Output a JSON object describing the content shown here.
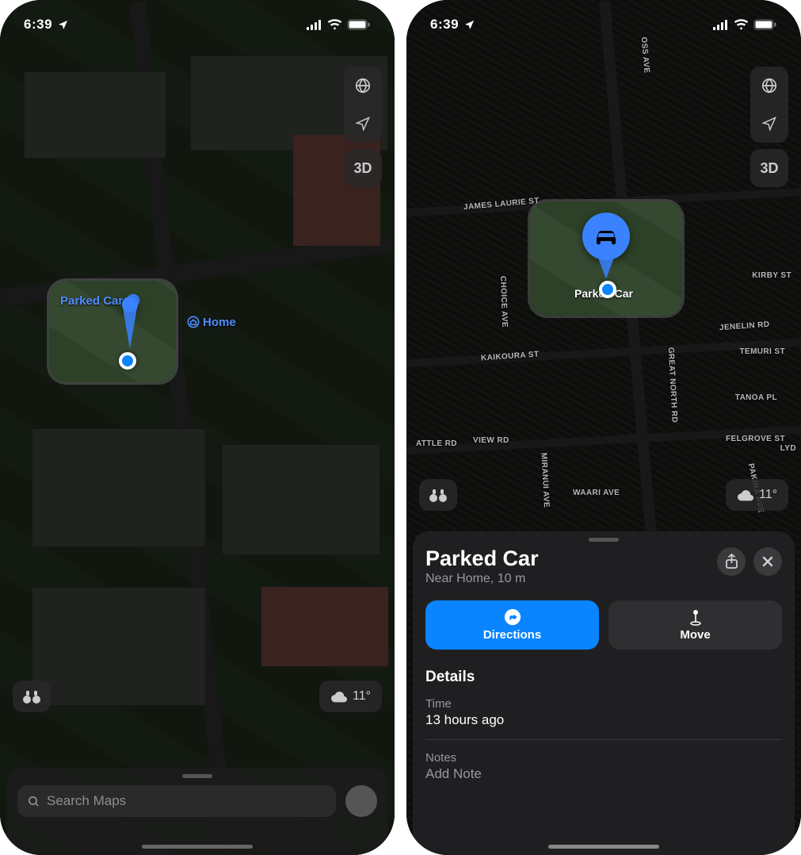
{
  "status": {
    "time": "6:39",
    "location_active": true
  },
  "controls": {
    "view_3d": "3D"
  },
  "weather": {
    "temp": "11°"
  },
  "left": {
    "search_placeholder": "Search Maps",
    "labels": {
      "parked_car": "Parked Car",
      "home": "Home"
    }
  },
  "right": {
    "title": "Parked Car",
    "subtitle": "Near Home, 10 m",
    "directions_label": "Directions",
    "move_label": "Move",
    "details_heading": "Details",
    "time_label": "Time",
    "time_value": "13 hours ago",
    "notes_label": "Notes",
    "notes_placeholder": "Add Note",
    "popout_label": "Parked Car",
    "streets": {
      "oss_ave": "OSS AVE",
      "james_laurie": "JAMES LAURIE ST",
      "kirby": "KIRBY ST",
      "choice": "CHOICE AVE",
      "jenelin": "JENELIN RD",
      "kaikoura": "KAIKOURA ST",
      "temuri": "TEMURI ST",
      "great_north": "GREAT NORTH RD",
      "tanoa": "TANOA PL",
      "view": "VIEW RD",
      "felgrove": "FELGROVE ST",
      "attle": "ATTLE RD",
      "waari": "WAARI AVE",
      "pakira": "PAKIRA AVE",
      "miranui": "MIRANUI AVE",
      "lyd": "LYD"
    }
  }
}
